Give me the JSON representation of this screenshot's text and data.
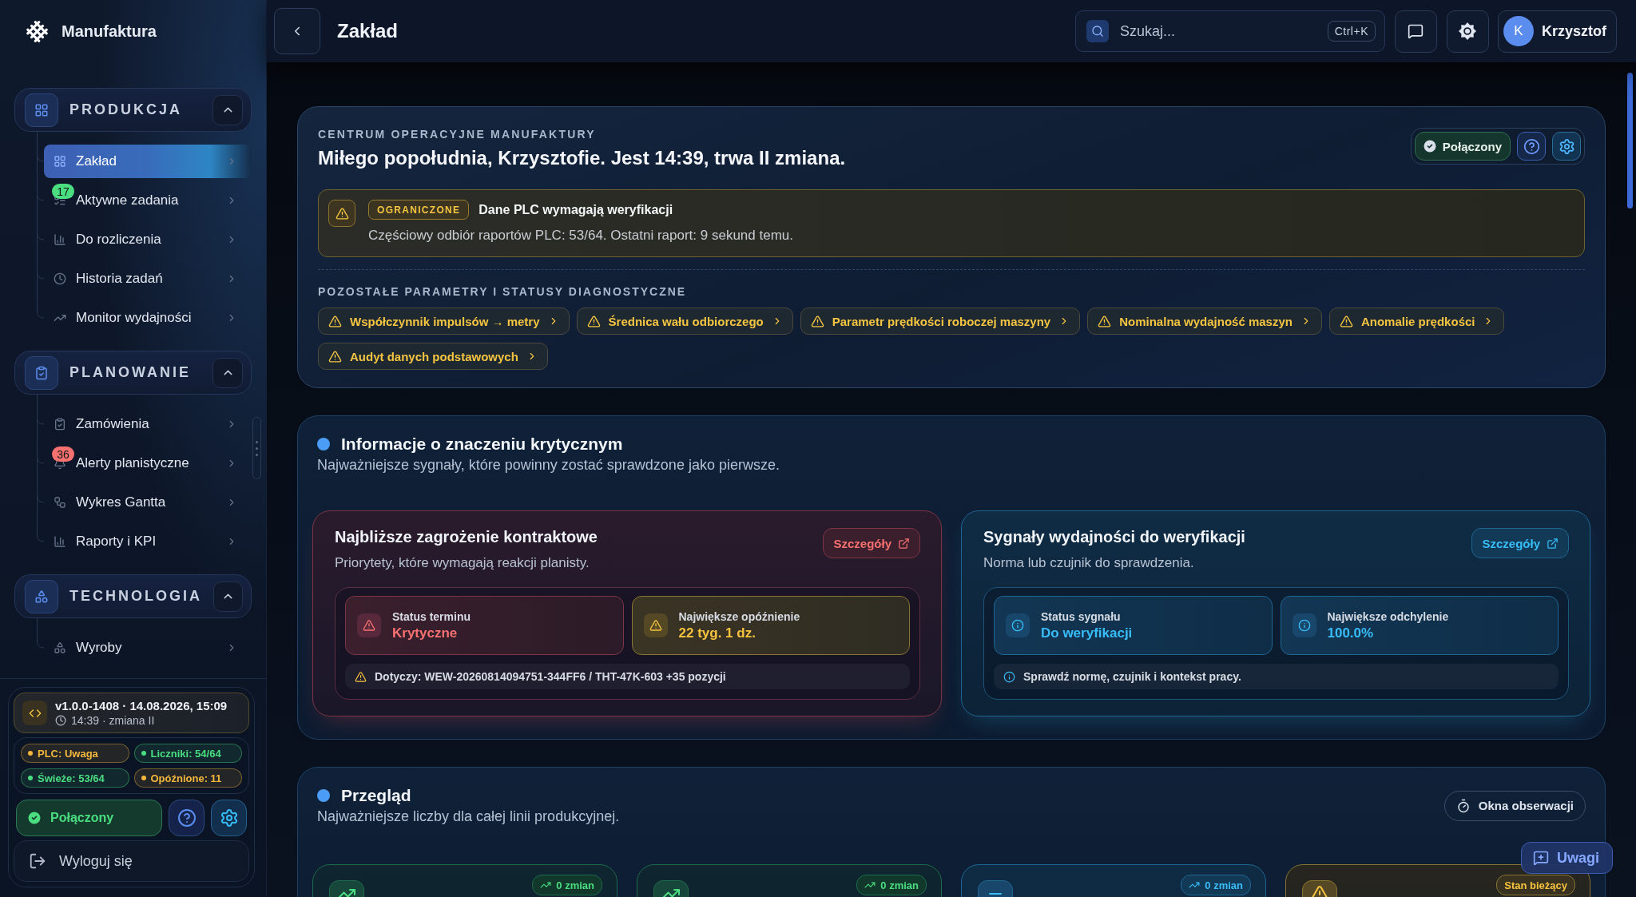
{
  "sidebar": {
    "brand": "Manufaktura",
    "groups": [
      {
        "title": "PRODUKCJA",
        "expanded": true,
        "items": [
          {
            "label": "Zakład",
            "selected": true
          },
          {
            "label": "Aktywne zadania",
            "selected": false,
            "badge": {
              "text": "17",
              "color": "#4ade80"
            }
          },
          {
            "label": "Do rozliczenia",
            "selected": false
          },
          {
            "label": "Historia zadań",
            "selected": false
          },
          {
            "label": "Monitor wydajności",
            "selected": false
          }
        ]
      },
      {
        "title": "PLANOWANIE",
        "expanded": true,
        "items": [
          {
            "label": "Zamówienia",
            "selected": false
          },
          {
            "label": "Alerty planistyczne",
            "selected": false,
            "badge": {
              "text": "36",
              "color": "#f87171"
            }
          },
          {
            "label": "Wykres Gantta",
            "selected": false
          },
          {
            "label": "Raporty i KPI",
            "selected": false
          }
        ]
      },
      {
        "title": "TECHNOLOGIA",
        "expanded": true,
        "items": [
          {
            "label": "Wyroby",
            "selected": false
          }
        ]
      }
    ],
    "build": {
      "version": "v1.0.0-1408 · 14.08.2026, 15:09",
      "shift": "14:39 · zmiana II"
    },
    "status_chips": [
      {
        "label": "PLC: Uwaga",
        "color": "#f5b83d"
      },
      {
        "label": "Liczniki: 54/64",
        "color": "#4ade80"
      },
      {
        "label": "Świeże: 53/64",
        "color": "#4ade80"
      },
      {
        "label": "Opóźnione: 11",
        "color": "#f5b83d"
      }
    ],
    "connection": {
      "label": "Połączony"
    },
    "logout": "Wyloguj się"
  },
  "header": {
    "title": "Zakład",
    "search": {
      "placeholder": "Szukaj...",
      "shortcut": "Ctrl+K"
    },
    "user": {
      "initial": "K",
      "name": "Krzysztof"
    }
  },
  "operations": {
    "eyebrow": "CENTRUM OPERACYJNE MANUFAKTURY",
    "greeting": "Miłego popołudnia, Krzysztofie. Jest 14:39, trwa II zmiana.",
    "status": "Połączony",
    "alert": {
      "badge": "OGRANICZONE",
      "title": "Dane PLC wymagają weryfikacji",
      "text": "Częściowy odbiór raportów PLC: 53/64. Ostatni raport: 9 sekund temu."
    },
    "diagnostics": {
      "title": "POZOSTAŁE PARAMETRY I STATUSY DIAGNOSTYCZNE",
      "chips": [
        "Współczynnik impulsów → metry",
        "Średnica wału odbiorczego",
        "Parametr prędkości roboczej maszyny",
        "Nominalna wydajność maszyn",
        "Anomalie prędkości",
        "Audyt danych podstawowych"
      ]
    }
  },
  "critical": {
    "title": "Informacje o znaczeniu krytycznym",
    "subtitle": "Najważniejsze sygnały, które powinny zostać sprawdzone jako pierwsze.",
    "cards": [
      {
        "kind": "critical",
        "title": "Najbliższe zagrożenie kontraktowe",
        "subtitle": "Priorytety, które wymagają reakcji planisty.",
        "action": "Szczegóły",
        "stats": [
          {
            "kind": "critical",
            "label": "Status terminu",
            "value": "Krytyczne"
          },
          {
            "kind": "warning",
            "label": "Największe opóźnienie",
            "value": "22 tyg. 1 dz."
          }
        ],
        "note": {
          "kind": "warning",
          "text": "Dotyczy: WEW-20260814094751-344FF6 / THT-47K-603 +35 pozycji"
        }
      },
      {
        "kind": "info",
        "title": "Sygnały wydajności do weryfikacji",
        "subtitle": "Norma lub czujnik do sprawdzenia.",
        "action": "Szczegóły",
        "stats": [
          {
            "kind": "info",
            "label": "Status sygnału",
            "value": "Do weryfikacji"
          },
          {
            "kind": "info",
            "label": "Największe odchylenie",
            "value": "100.0%"
          }
        ],
        "note": {
          "kind": "info",
          "text": "Sprawdź normę, czujnik i kontekst pracy."
        }
      }
    ]
  },
  "overview": {
    "title": "Przegląd",
    "subtitle": "Najważniejsze liczby dla całej linii produkcyjnej.",
    "action": "Okna obserwacji",
    "kpis": [
      {
        "kind": "good",
        "badge": "0 zmian"
      },
      {
        "kind": "good",
        "badge": "0 zmian"
      },
      {
        "kind": "info",
        "badge": "0 zmian"
      },
      {
        "kind": "warning",
        "badge": "Stan bieżący"
      }
    ]
  },
  "feedback": {
    "label": "Uwagi"
  }
}
